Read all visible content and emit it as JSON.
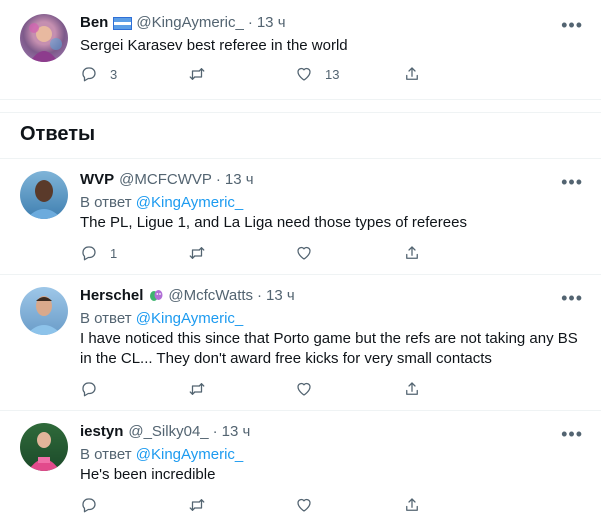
{
  "main_tweet": {
    "name": "Ben",
    "handle": "@KingAymeric_",
    "time": "13 ч",
    "text": "Sergei Karasev best referee in the world",
    "reply_count": "3",
    "like_count": "13"
  },
  "replies_header": "Ответы",
  "reply_prefix": "В ответ",
  "reply_to_handle": "@KingAymeric_",
  "replies": [
    {
      "name": "WVP",
      "handle": "@MCFCWVP",
      "time": "13 ч",
      "text": "The PL, Ligue 1, and La Liga need those types of referees",
      "reply_count": "1",
      "like_count": ""
    },
    {
      "name": "Herschel",
      "handle": "@McfcWatts",
      "time": "13 ч",
      "text": "I have noticed this since that Porto game but the refs are not taking any BS in the CL... They don't award free kicks for very small contacts",
      "reply_count": "",
      "like_count": ""
    },
    {
      "name": "iestyn",
      "handle": "@_Silky04_",
      "time": "13 ч",
      "text": "He's been incredible",
      "reply_count": "",
      "like_count": ""
    }
  ],
  "separator": "·",
  "more_label": "•••",
  "colors": {
    "link": "#1d9bf0",
    "muted": "#536471",
    "text": "#0f1419"
  },
  "icons": [
    "reply-icon",
    "retweet-icon",
    "like-icon",
    "share-icon",
    "more-icon",
    "flag-icon",
    "mask-badge-icon"
  ]
}
